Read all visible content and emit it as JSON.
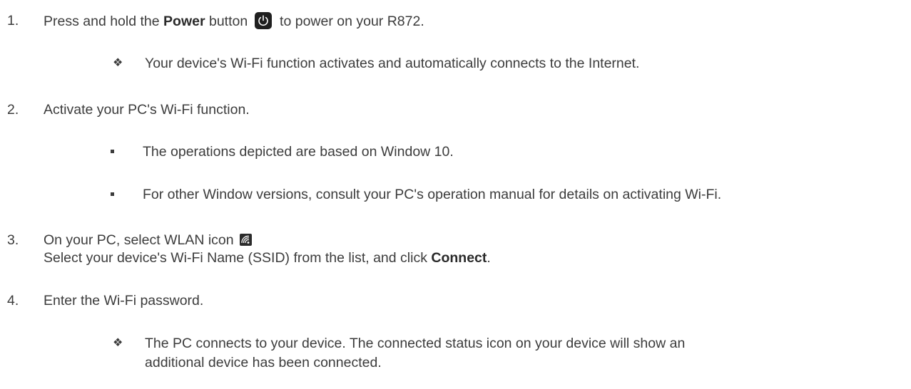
{
  "steps": [
    {
      "number": "1.",
      "pre": "Press and hold the ",
      "bold": "Power",
      "mid": " button",
      "post": " to power on your R872.",
      "icon": "power-icon",
      "sub": [
        {
          "bullet": "diamond",
          "text": "Your device's Wi-Fi function activates and automatically connects to the Internet."
        }
      ]
    },
    {
      "number": "2.",
      "text": "Activate your PC's Wi-Fi function.",
      "sub": [
        {
          "bullet": "square",
          "text": "The operations depicted are based on Window 10."
        },
        {
          "bullet": "square",
          "text": "For other Window versions, consult your PC's operation manual for details on activating Wi-Fi."
        }
      ]
    },
    {
      "number": "3.",
      "line1": "On your PC, select WLAN icon",
      "icon": "wlan-icon",
      "line2_pre": "Select your device's Wi-Fi Name (SSID) from the list, and click ",
      "line2_bold": "Connect",
      "line2_post": "."
    },
    {
      "number": "4.",
      "text": "Enter the Wi-Fi password.",
      "sub": [
        {
          "bullet": "diamond",
          "line1": "The PC connects to your device. The connected status icon on your device will show an",
          "line2": "additional device has been connected."
        }
      ]
    }
  ]
}
